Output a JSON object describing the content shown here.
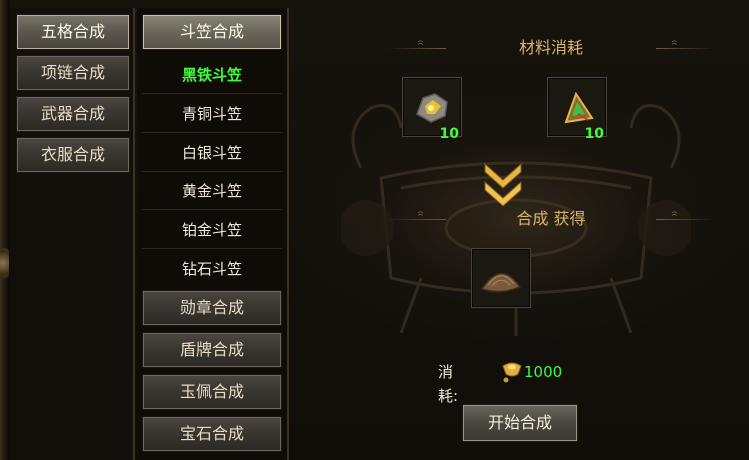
{
  "categories": [
    {
      "label": "五格合成",
      "active": true
    },
    {
      "label": "项链合成",
      "active": false
    },
    {
      "label": "武器合成",
      "active": false
    },
    {
      "label": "衣服合成",
      "active": false
    }
  ],
  "groups": {
    "hat": {
      "label": "斗笠合成"
    },
    "items": [
      "黑铁斗笠",
      "青铜斗笠",
      "白银斗笠",
      "黄金斗笠",
      "铂金斗笠",
      "钻石斗笠"
    ],
    "selected_item": "黑铁斗笠",
    "medal": {
      "label": "勋章合成"
    },
    "shield": {
      "label": "盾牌合成"
    },
    "jade": {
      "label": "玉佩合成"
    },
    "gem": {
      "label": "宝石合成"
    }
  },
  "main": {
    "materials_title": "材料消耗",
    "materials": [
      {
        "icon": "ore-icon",
        "count": "10"
      },
      {
        "icon": "hat-fragment-icon",
        "count": "10"
      }
    ],
    "result_title": "合成 获得",
    "result": {
      "icon": "black-iron-hat-icon"
    },
    "cost_label": "消耗:",
    "cost_icon": "gold-ingot-icon",
    "cost_value": "1000",
    "start_button": "开始合成"
  },
  "colors": {
    "highlight_green": "#3cff3c",
    "title_gold": "#d9b46c"
  }
}
